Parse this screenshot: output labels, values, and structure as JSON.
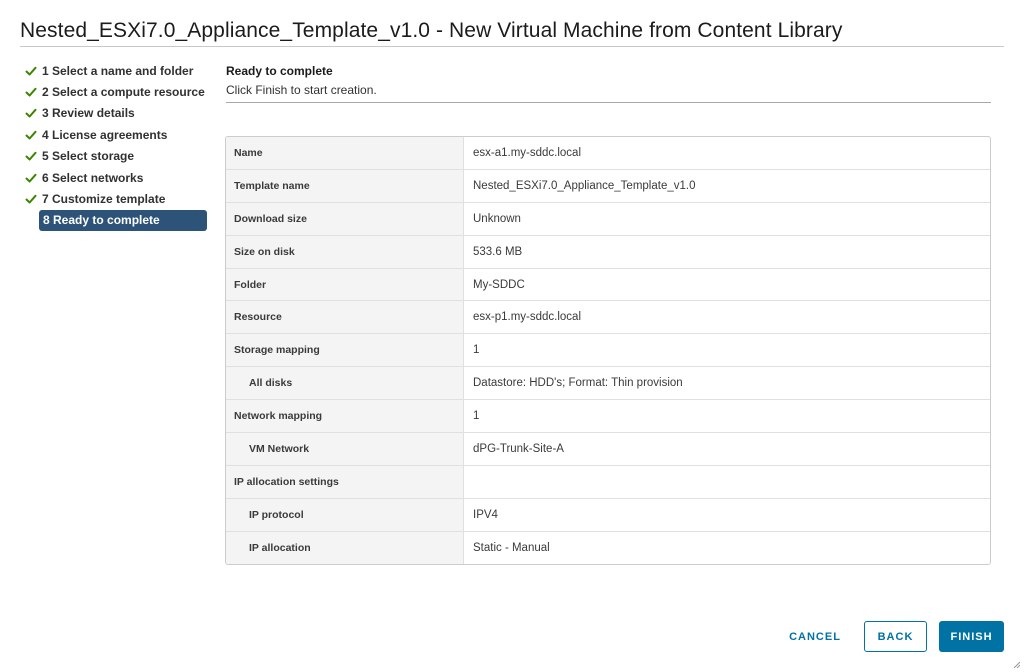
{
  "dialog": {
    "title": "Nested_ESXi7.0_Appliance_Template_v1.0 - New Virtual Machine from Content Library"
  },
  "steps": [
    {
      "label": "1 Select a name and folder",
      "done": true
    },
    {
      "label": "2 Select a compute resource",
      "done": true
    },
    {
      "label": "3 Review details",
      "done": true
    },
    {
      "label": "4 License agreements",
      "done": true
    },
    {
      "label": "5 Select storage",
      "done": true
    },
    {
      "label": "6 Select networks",
      "done": true
    },
    {
      "label": "7 Customize template",
      "done": true
    },
    {
      "label": "8 Ready to complete",
      "done": false,
      "active": true
    }
  ],
  "pane": {
    "title": "Ready to complete",
    "subtitle": "Click Finish to start creation."
  },
  "summary": [
    {
      "key": "Name",
      "value": "esx-a1.my-sddc.local",
      "sub": false
    },
    {
      "key": "Template name",
      "value": "Nested_ESXi7.0_Appliance_Template_v1.0",
      "sub": false
    },
    {
      "key": "Download size",
      "value": "Unknown",
      "sub": false
    },
    {
      "key": "Size on disk",
      "value": "533.6 MB",
      "sub": false
    },
    {
      "key": "Folder",
      "value": "My-SDDC",
      "sub": false
    },
    {
      "key": "Resource",
      "value": "esx-p1.my-sddc.local",
      "sub": false
    },
    {
      "key": "Storage mapping",
      "value": "1",
      "sub": false
    },
    {
      "key": "All disks",
      "value": "Datastore: HDD's; Format: Thin provision",
      "sub": true
    },
    {
      "key": "Network mapping",
      "value": "1",
      "sub": false
    },
    {
      "key": "VM Network",
      "value": "dPG-Trunk-Site-A",
      "sub": true
    },
    {
      "key": "IP allocation settings",
      "value": "",
      "sub": false
    },
    {
      "key": "IP protocol",
      "value": "IPV4",
      "sub": true
    },
    {
      "key": "IP allocation",
      "value": "Static - Manual",
      "sub": true
    }
  ],
  "buttons": {
    "cancel": "CANCEL",
    "back": "BACK",
    "finish": "FINISH"
  },
  "colors": {
    "check": "#3c8500",
    "active_step": "#2e5379",
    "primary": "#0072a3"
  },
  "icons": {
    "step_done": "checkmark-icon",
    "resize": "resize-grip-icon"
  }
}
